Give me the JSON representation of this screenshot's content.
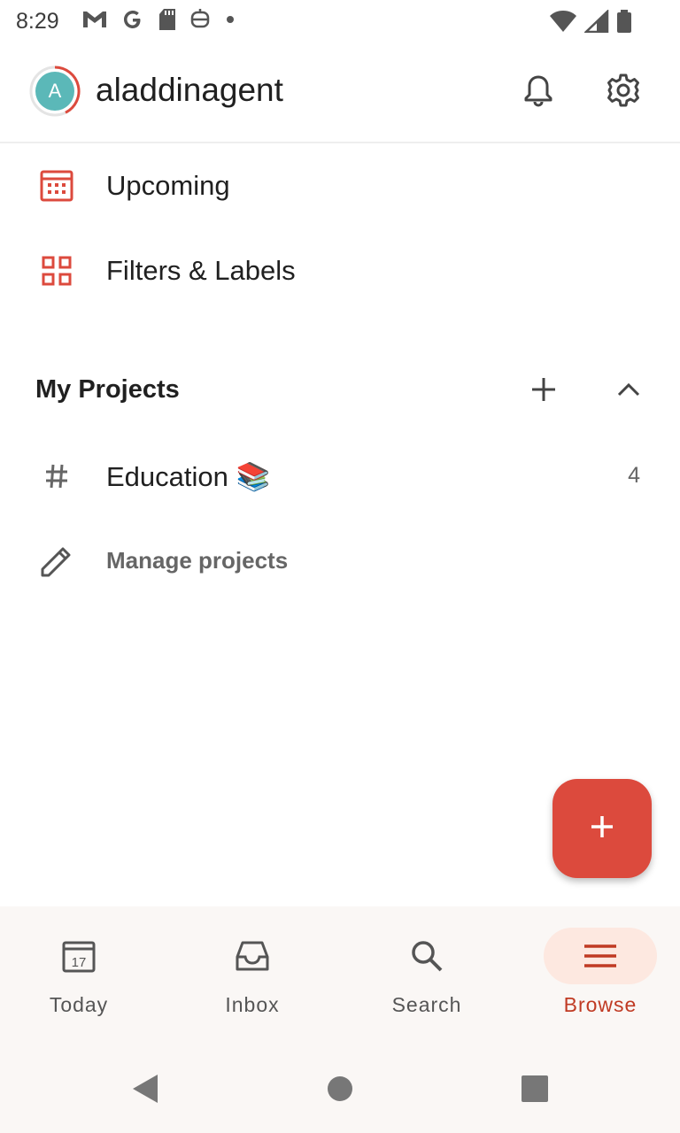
{
  "status_bar": {
    "time": "8:29",
    "left_icons": [
      "gmail-icon",
      "google-icon",
      "sd-card-icon",
      "assistant-icon",
      "dot-icon"
    ],
    "right_icons": [
      "wifi-icon",
      "signal-icon",
      "battery-icon"
    ]
  },
  "header": {
    "avatar_initial": "A",
    "username": "aladdinagent",
    "actions": [
      "bell-icon",
      "gear-icon"
    ]
  },
  "menu": {
    "upcoming_label": "Upcoming",
    "filters_label": "Filters & Labels"
  },
  "projects": {
    "section_title": "My Projects",
    "items": [
      {
        "label": "Education 📚",
        "count": "4"
      }
    ],
    "manage_label": "Manage projects"
  },
  "bottom_nav": {
    "items": [
      {
        "label": "Today",
        "icon": "calendar-today-icon"
      },
      {
        "label": "Inbox",
        "icon": "inbox-icon"
      },
      {
        "label": "Search",
        "icon": "search-icon"
      },
      {
        "label": "Browse",
        "icon": "menu-icon",
        "active": true
      }
    ]
  },
  "colors": {
    "accent": "#dc4a3d",
    "active_nav_bg": "#fde8e0",
    "active_nav_text": "#c03a23"
  }
}
